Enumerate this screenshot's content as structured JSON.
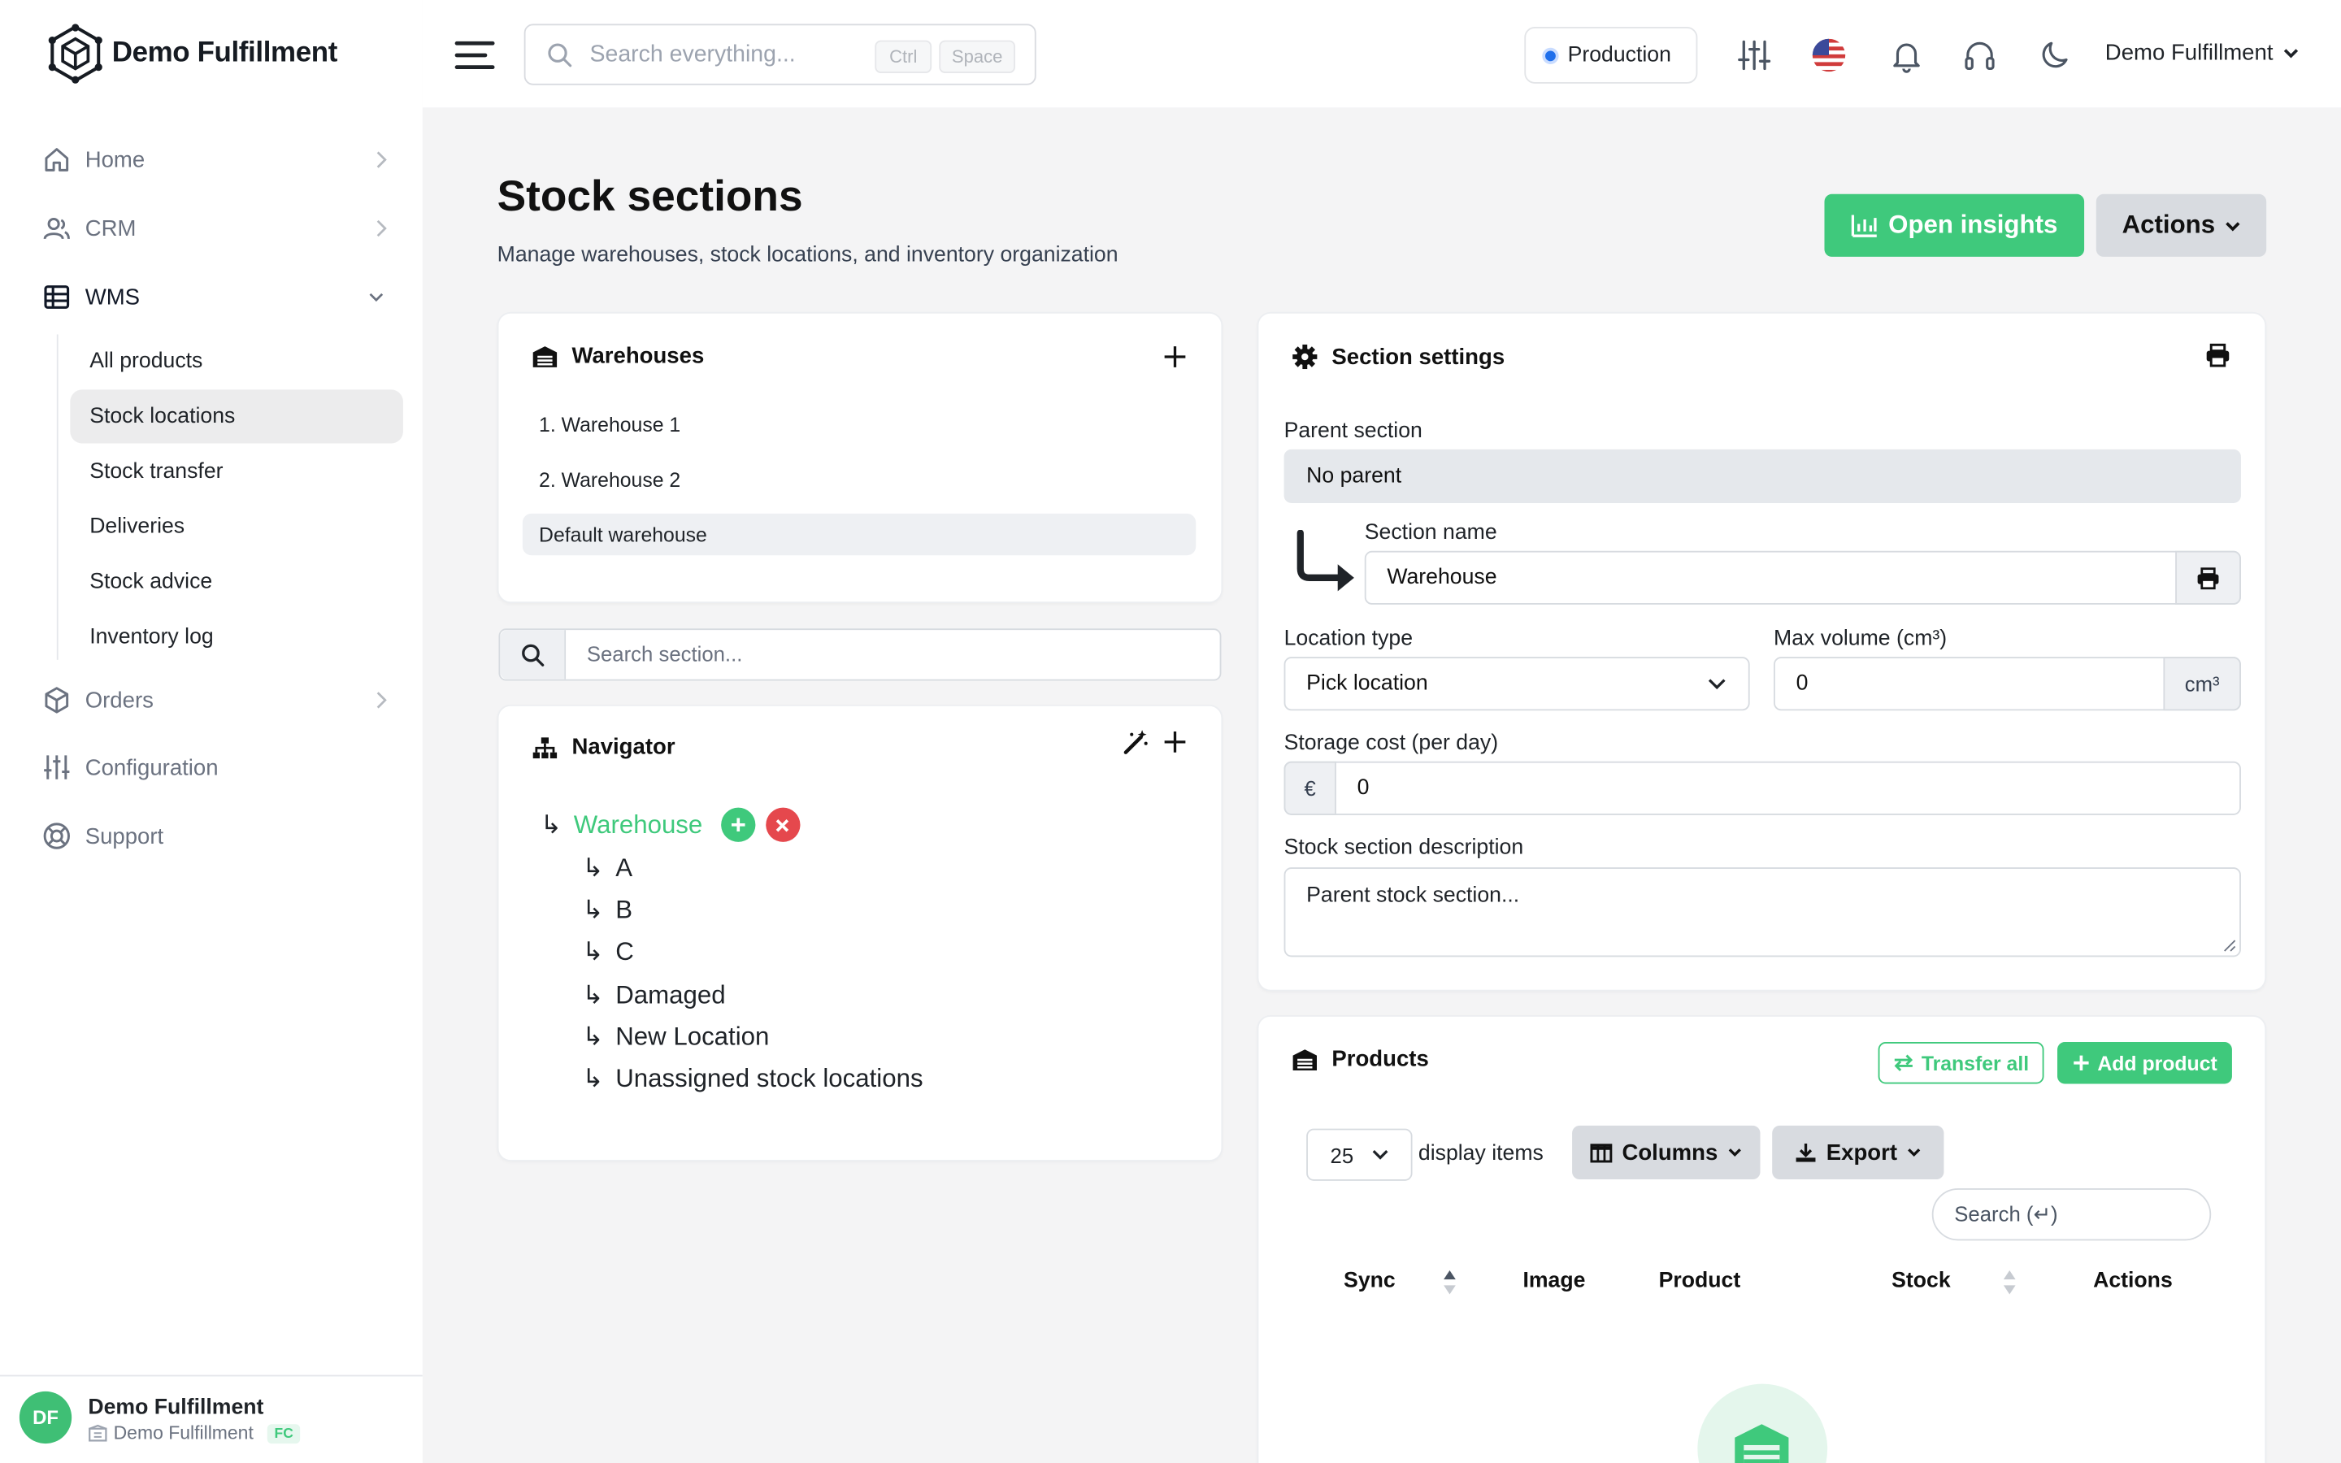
{
  "brand": {
    "name": "Demo Fulfillment",
    "logo_icon": "hexagon-network-icon"
  },
  "sidebar": {
    "items": [
      {
        "label": "Home",
        "icon": "home-icon"
      },
      {
        "label": "CRM",
        "icon": "users-icon"
      },
      {
        "label": "WMS",
        "icon": "table-icon"
      },
      {
        "label": "Orders",
        "icon": "cube-icon"
      },
      {
        "label": "Configuration",
        "icon": "sliders-icon"
      },
      {
        "label": "Support",
        "icon": "lifebuoy-icon"
      }
    ],
    "wms_sub": [
      "All products",
      "Stock locations",
      "Stock transfer",
      "Deliveries",
      "Stock advice",
      "Inventory log"
    ],
    "footer": {
      "initials": "DF",
      "name": "Demo Fulfillment",
      "org": "Demo Fulfillment",
      "badge": "FC"
    }
  },
  "topbar": {
    "search_placeholder": "Search everything...",
    "kbd": [
      "Ctrl",
      "Space"
    ],
    "environment": "Production",
    "user_menu": "Demo Fulfillment"
  },
  "page": {
    "title": "Stock sections",
    "subtitle": "Manage warehouses, stock locations, and inventory organization",
    "insights_button": "Open insights",
    "actions_button": "Actions"
  },
  "warehouses": {
    "title": "Warehouses",
    "items": [
      "1. Warehouse 1",
      "2. Warehouse 2",
      "Default warehouse"
    ]
  },
  "section_search": {
    "placeholder": "Search section..."
  },
  "navigator": {
    "title": "Navigator",
    "root": "Warehouse",
    "children": [
      "A",
      "B",
      "C",
      "Damaged",
      "New Location",
      "Unassigned stock locations"
    ]
  },
  "settings": {
    "title": "Section settings",
    "parent_label": "Parent section",
    "parent_value": "No parent",
    "name_label": "Section name",
    "name_value": "Warehouse",
    "location_type_label": "Location type",
    "location_type_value": "Pick location",
    "max_volume_label": "Max volume (cm³)",
    "max_volume_value": "0",
    "max_volume_unit": "cm³",
    "storage_cost_label": "Storage cost (per day)",
    "storage_cost_currency": "€",
    "storage_cost_value": "0",
    "description_label": "Stock section description",
    "description_placeholder": "Parent stock section..."
  },
  "products": {
    "title": "Products",
    "transfer_all": "Transfer all",
    "add_product": "Add product",
    "page_size": "25",
    "display_items": "display items",
    "columns_button": "Columns",
    "export_button": "Export",
    "search_placeholder": "Search (↵)",
    "headers": [
      "Sync",
      "Image",
      "Product",
      "Stock",
      "Actions"
    ]
  },
  "colors": {
    "accent": "#3fc97c",
    "danger": "#e5484d",
    "env_dot": "#1f6feb"
  }
}
